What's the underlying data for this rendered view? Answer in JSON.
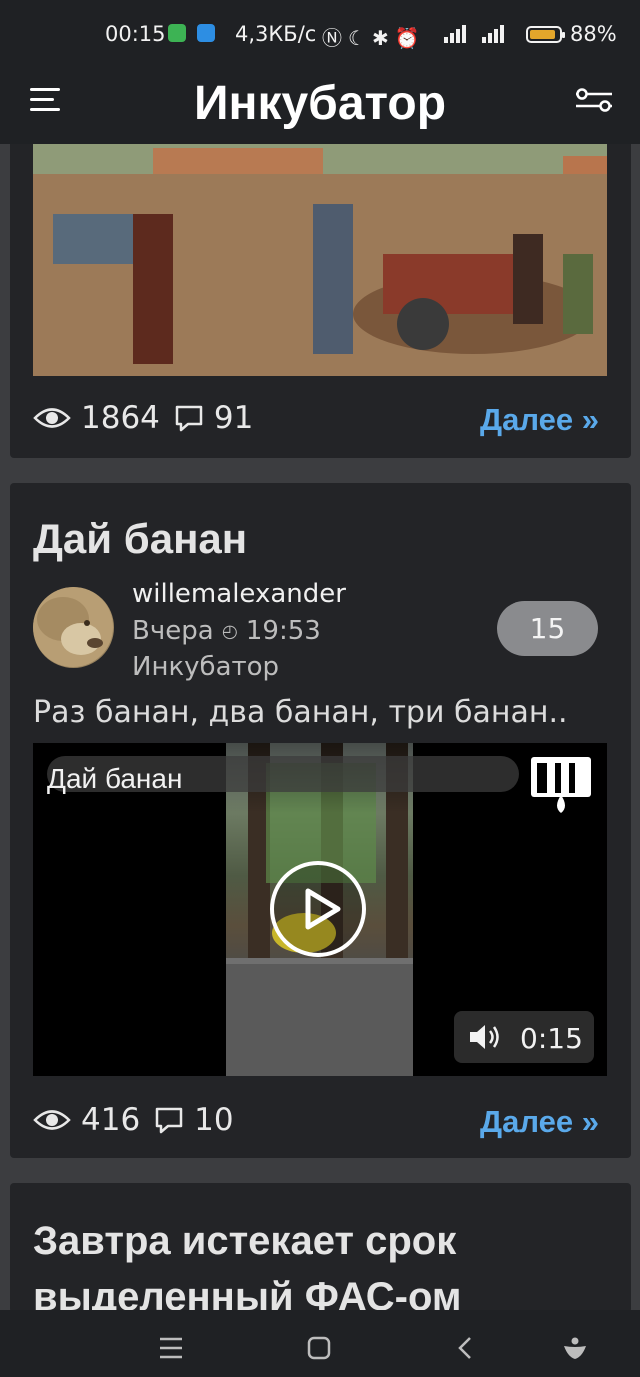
{
  "status_bar": {
    "time": "00:15",
    "speed": "4,3КБ/с",
    "battery": "88%",
    "battery_level": 0.88,
    "icons": [
      "android-icon",
      "mail-icon",
      "nfc-icon",
      "moon-icon",
      "bluetooth-icon",
      "alarm-icon",
      "signal-icon",
      "battery-icon"
    ]
  },
  "app_bar": {
    "title": "Инкубатор"
  },
  "posts": [
    {
      "views": "1864",
      "comments": "91",
      "more": "Далее »"
    },
    {
      "title": "Дай банан",
      "author": "willemalexander",
      "date_label": "Вчера",
      "time": "19:53",
      "community": "Инкубатор",
      "rating": "15",
      "text": "Раз банан, два банан, три банан..",
      "video": {
        "title": "Дай банан",
        "duration": "0:15"
      },
      "views": "416",
      "comments": "10",
      "more": "Далее »"
    },
    {
      "title": "Завтра истекает срок выделенный ФАС-ом"
    }
  ],
  "colors": {
    "background": "#3c3d40",
    "card": "#232427",
    "bar": "#1f2124",
    "link": "#5aa9ea",
    "rating": "#8a8b8e"
  }
}
